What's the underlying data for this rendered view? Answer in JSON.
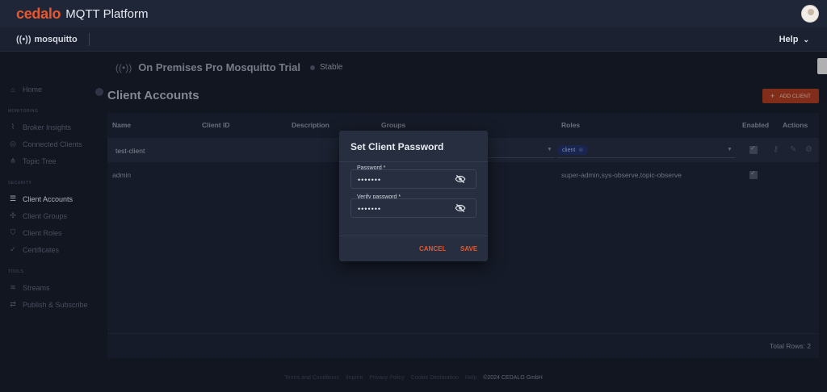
{
  "topbar": {
    "brand": "cedalo",
    "platform": "MQTT Platform"
  },
  "subbar": {
    "logo_text": "mosquitto",
    "help_label": "Help"
  },
  "instance": {
    "name": "On Premises Pro Mosquitto Trial",
    "status": "Stable"
  },
  "sidebar": {
    "home": "Home",
    "monitoring_label": "MONITORING",
    "monitoring": [
      "Broker Insights",
      "Connected Clients",
      "Topic Tree"
    ],
    "security_label": "SECURITY",
    "security": [
      "Client Accounts",
      "Client Groups",
      "Client Roles",
      "Certificates"
    ],
    "tools_label": "TOOLS",
    "tools": [
      "Streams",
      "Publish & Subscribe"
    ]
  },
  "page": {
    "title": "Client Accounts",
    "add_button": "ADD CLIENT"
  },
  "table": {
    "headers": [
      "Name",
      "Client ID",
      "Description",
      "Groups",
      "Roles",
      "Enabled",
      "Actions"
    ],
    "rows": [
      {
        "name": "test-client",
        "client_id": "",
        "description": "",
        "groups": "",
        "roles": "client"
      },
      {
        "name": "admin",
        "client_id": "",
        "description": "",
        "groups": "",
        "roles": "super-admin,sys-observe,topic-observe"
      }
    ],
    "total_rows": "Total Rows: 2"
  },
  "footer": {
    "links": [
      "Terms and Conditions",
      "Imprint",
      "Privacy Policy",
      "Cookie Declaration",
      "Help"
    ],
    "copyright": "©2024 CEDALO GmbH"
  },
  "modal": {
    "title": "Set Client Password",
    "password_label": "Password *",
    "password_value": "•••••••",
    "verify_label": "Verify password *",
    "verify_value": "•••••••",
    "cancel": "CANCEL",
    "save": "SAVE"
  },
  "colors": {
    "accent": "#e8572d",
    "background": "#151a26",
    "modal": "#262e40"
  }
}
